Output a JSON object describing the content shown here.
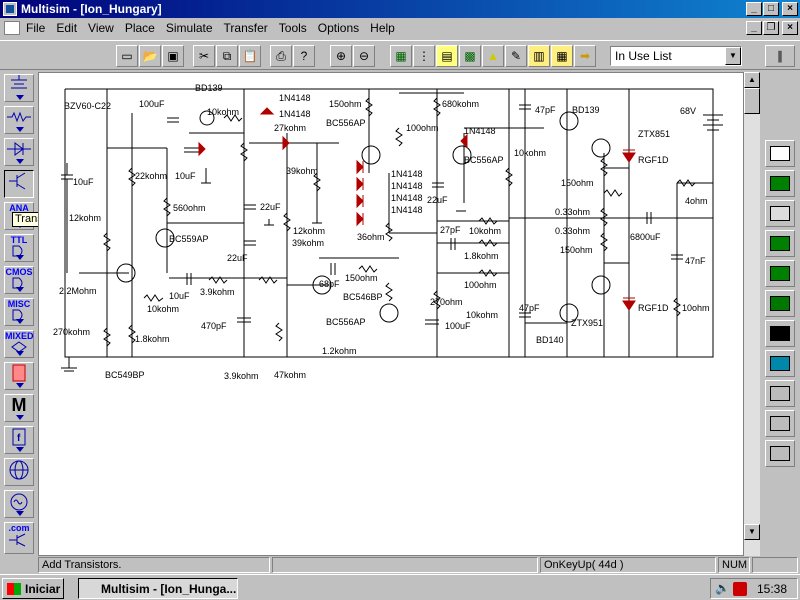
{
  "window": {
    "title": "Multisim - [Ion_Hungary]"
  },
  "menu": [
    "File",
    "Edit",
    "View",
    "Place",
    "Simulate",
    "Transfer",
    "Tools",
    "Options",
    "Help"
  ],
  "toolbar": {
    "dropdown_value": "In Use List"
  },
  "left_tools": [
    "power-sources",
    "basic",
    "diodes",
    "transistors",
    "analog",
    "ttl",
    "cmos",
    "misc-digital",
    "mixed",
    "indicators",
    "misc",
    "controls",
    "rf",
    "electromechanical",
    "ladder"
  ],
  "left_tool_labels": {
    "analog": "ANA",
    "ttl": "TTL",
    "cmos": "CMOS",
    "misc": "MISC",
    "mixed": "MIXED",
    "com": ".com"
  },
  "tooltip": "Transistors",
  "schematic": {
    "labels": [
      {
        "t": "BZV60-C22"
      },
      {
        "t": "100uF"
      },
      {
        "t": "BD139"
      },
      {
        "t": "10kohm"
      },
      {
        "t": "1N4148"
      },
      {
        "t": "1N4148"
      },
      {
        "t": "27kohm"
      },
      {
        "t": "150ohm"
      },
      {
        "t": "BC556AP"
      },
      {
        "t": "680kohm"
      },
      {
        "t": "100ohm"
      },
      {
        "t": "1N4148"
      },
      {
        "t": "47pF"
      },
      {
        "t": "BD139"
      },
      {
        "t": "68V"
      },
      {
        "t": "10uF"
      },
      {
        "t": "10uF"
      },
      {
        "t": "22kohm"
      },
      {
        "t": "12kohm"
      },
      {
        "t": "560ohm"
      },
      {
        "t": "39kohm"
      },
      {
        "t": "1N4148"
      },
      {
        "t": "1N4148"
      },
      {
        "t": "1N4148"
      },
      {
        "t": "1N4148"
      },
      {
        "t": "BC556AP"
      },
      {
        "t": "10kohm"
      },
      {
        "t": "ZTX851"
      },
      {
        "t": "RGF1D"
      },
      {
        "t": "22uF"
      },
      {
        "t": "22uF"
      },
      {
        "t": "150ohm"
      },
      {
        "t": "BC559AP"
      },
      {
        "t": "12kohm"
      },
      {
        "t": "39kohm"
      },
      {
        "t": "36ohm"
      },
      {
        "t": "0.33ohm"
      },
      {
        "t": "4ohm"
      },
      {
        "t": "22uF"
      },
      {
        "t": "27pF"
      },
      {
        "t": "10kohm"
      },
      {
        "t": "0.33ohm"
      },
      {
        "t": "6800uF"
      },
      {
        "t": "150ohm"
      },
      {
        "t": "1.8kohm"
      },
      {
        "t": "47nF"
      },
      {
        "t": "2.2Mohm"
      },
      {
        "t": "68pF"
      },
      {
        "t": "150ohm"
      },
      {
        "t": "10uF"
      },
      {
        "t": "3.9kohm"
      },
      {
        "t": "BC546BP"
      },
      {
        "t": "100ohm"
      },
      {
        "t": "270ohm"
      },
      {
        "t": "10kohm"
      },
      {
        "t": "10kohm"
      },
      {
        "t": "47pF"
      },
      {
        "t": "RGF1D"
      },
      {
        "t": "10ohm"
      },
      {
        "t": "270kohm"
      },
      {
        "t": "470pF"
      },
      {
        "t": "BC556AP"
      },
      {
        "t": "100uF"
      },
      {
        "t": "ZTX951"
      },
      {
        "t": "1.8kohm"
      },
      {
        "t": "1.2kohm"
      },
      {
        "t": "BD140"
      },
      {
        "t": "BC549BP"
      },
      {
        "t": "3.9kohm"
      },
      {
        "t": "47kohm"
      }
    ]
  },
  "status": {
    "hint": "Add Transistors.",
    "event": "OnKeyUp( 44d )",
    "numlock": "NUM"
  },
  "taskbar": {
    "start": "Iniciar",
    "task": "Multisim - [Ion_Hunga...",
    "clock": "15:38"
  }
}
